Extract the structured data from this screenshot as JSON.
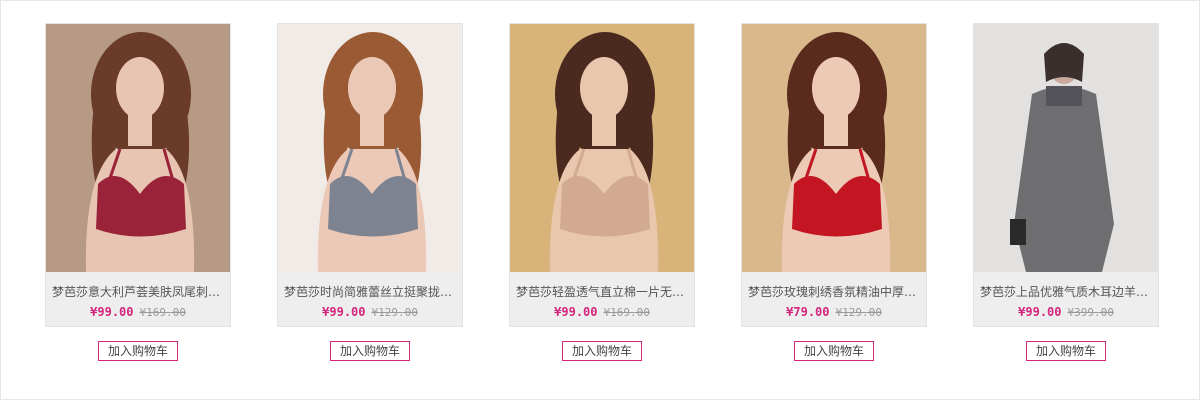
{
  "products": [
    {
      "name": "梦芭莎意大利芦荟美肤凤尾刺…",
      "price": "¥99.00",
      "original_price": "¥169.00",
      "add_to_cart": "加入购物车",
      "image_colors": {
        "bg": "#b79a86",
        "skin": "#e8c4b2",
        "garment": "#9b2339",
        "hair": "#6a3b28"
      }
    },
    {
      "name": "梦芭莎时尚简雅蕾丝立挺聚拢…",
      "price": "¥99.00",
      "original_price": "¥129.00",
      "add_to_cart": "加入购物车",
      "image_colors": {
        "bg": "#f0ebe6",
        "skin": "#ecc8b6",
        "garment": "#7d8391",
        "hair": "#9a5a33"
      }
    },
    {
      "name": "梦芭莎轻盈透气直立棉一片无…",
      "price": "¥99.00",
      "original_price": "¥169.00",
      "add_to_cart": "加入购物车",
      "image_colors": {
        "bg": "#d8b47a",
        "skin": "#e9c6ae",
        "garment": "#d1aa91",
        "hair": "#4a2a1e"
      }
    },
    {
      "name": "梦芭莎玫瑰刺绣香氛精油中厚…",
      "price": "¥79.00",
      "original_price": "¥129.00",
      "add_to_cart": "加入购物车",
      "image_colors": {
        "bg": "#d9b98c",
        "skin": "#eccab6",
        "garment": "#c41522",
        "hair": "#5a2b1d"
      }
    },
    {
      "name": "梦芭莎上品优雅气质木耳边羊…",
      "price": "¥99.00",
      "original_price": "¥399.00",
      "add_to_cart": "加入购物车",
      "image_colors": {
        "bg": "#e2e1e0",
        "skin": "#caa99a",
        "garment": "#6e6d70",
        "hair": "#3a2f2c"
      }
    }
  ]
}
